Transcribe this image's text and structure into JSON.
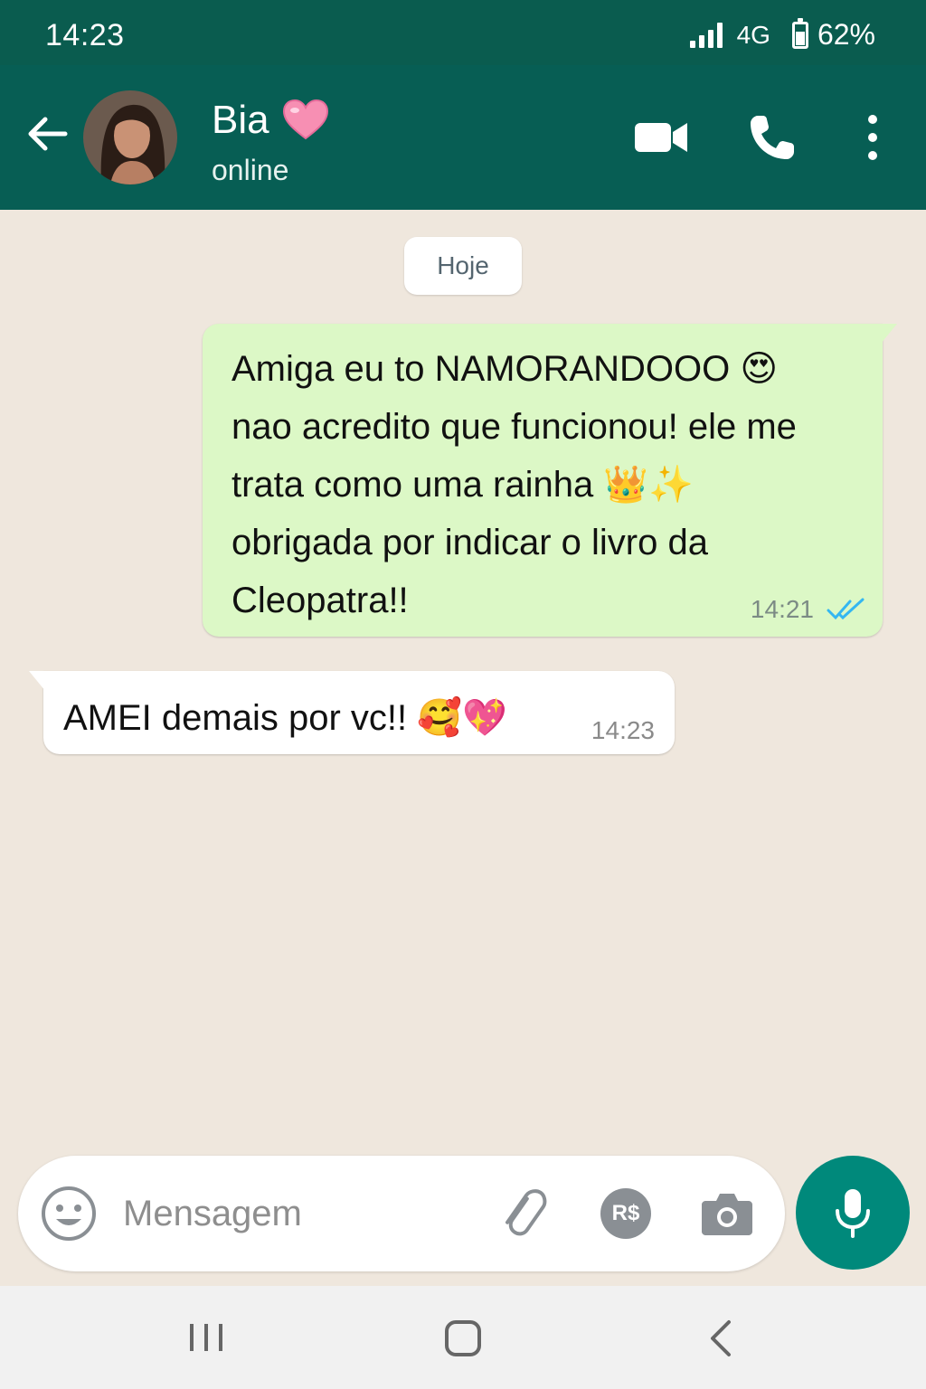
{
  "status_bar": {
    "time": "14:23",
    "network": "4G",
    "battery": "62%",
    "battery_level": 0.62
  },
  "header": {
    "contact_name": "Bia",
    "contact_status": "online",
    "icons": [
      "back-arrow-icon",
      "pink-heart-icon",
      "video-call-icon",
      "phone-call-icon",
      "more-options-icon"
    ]
  },
  "chat": {
    "date_chip": "Hoje",
    "messages": [
      {
        "direction": "outgoing",
        "lines": [
          "Amiga eu to NAMORANDOOO 😍",
          "nao acredito que funcionou! ele me",
          "trata como uma rainha 👑✨",
          "obrigada por indicar o livro da",
          "Cleopatra!!"
        ],
        "time": "14:21",
        "read": true
      },
      {
        "direction": "incoming",
        "text": "AMEI demais por vc!! 🥰💖",
        "time": "14:23"
      }
    ]
  },
  "composer": {
    "placeholder": "Mensagem",
    "pay_label": "R$",
    "icons": [
      "emoji-icon",
      "attach-icon",
      "payment-icon",
      "camera-icon",
      "microphone-icon"
    ]
  },
  "colors": {
    "header": "#075e54",
    "status_bar": "#0a5c4f",
    "outgoing_bubble": "#dcf8c6",
    "incoming_bubble": "#ffffff",
    "chat_background": "#efe7dd",
    "accent": "#00897b",
    "read_ticks": "#34b7f1"
  }
}
